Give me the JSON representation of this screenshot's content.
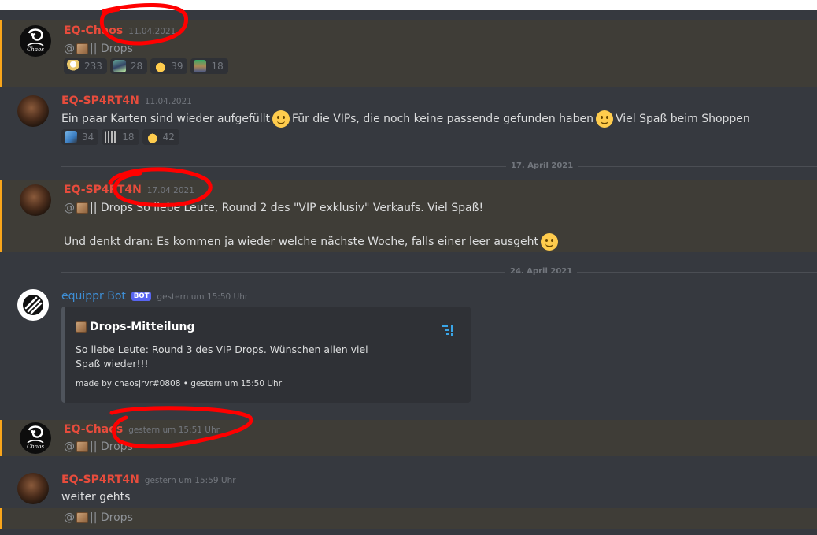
{
  "colors": {
    "background": "#36393f",
    "mention_highlight": "#3f3d37",
    "mention_border": "#faa61a",
    "username_red": "#e74c3c",
    "bot_name": "#3e8fd6",
    "timestamp": "#72767d",
    "annotation_red": "#ff0000"
  },
  "messages": [
    {
      "author": "EQ-Chaos",
      "timestamp": "11.04.2021",
      "at": "@",
      "role": "|| Drops",
      "reactions": [
        {
          "icon": "duck-emoji-icon",
          "count": "233"
        },
        {
          "icon": "loot-emoji-icon",
          "count": "28"
        },
        {
          "icon": "thumbs-up-icon",
          "count": "39"
        },
        {
          "icon": "hat-emoji-icon",
          "count": "18"
        }
      ]
    },
    {
      "author": "EQ-SP4RT4N",
      "timestamp": "11.04.2021",
      "text_a": "Ein paar Karten sind wieder aufgefüllt",
      "text_b": "Für die VIPs, die noch keine passende gefunden haben",
      "text_c": "Viel Spaß beim Shoppen",
      "reactions": [
        {
          "icon": "player-emoji-icon",
          "count": "34"
        },
        {
          "icon": "discount-off-icon",
          "count": "18"
        },
        {
          "icon": "thumbs-up-icon",
          "count": "42"
        }
      ]
    },
    {
      "author": "EQ-SP4RT4N",
      "timestamp": "17.04.2021",
      "at": "@",
      "text": "|| Drops So liebe Leute, Round 2 des \"VIP exklusiv\" Verkaufs. Viel Spaß!",
      "text2": "Und denkt dran: Es kommen ja wieder welche nächste Woche, falls einer leer ausgeht"
    },
    {
      "author": "equippr Bot",
      "badge": "BOT",
      "timestamp": "gestern um 15:50 Uhr",
      "embed": {
        "title": "Drops-Mitteilung",
        "description": "So liebe Leute: Round 3 des VIP Drops. Wünschen allen viel Spaß wieder!!!",
        "footer": "made by chaosjrvr#0808 • gestern um 15:50 Uhr"
      }
    },
    {
      "author": "EQ-Chaos",
      "timestamp": "gestern um 15:51 Uhr",
      "at": "@",
      "role": "|| Drops"
    },
    {
      "author": "EQ-SP4RT4N",
      "timestamp": "gestern um 15:59 Uhr",
      "text": "weiter gehts",
      "at": "@",
      "role": "|| Drops"
    }
  ],
  "dividers": [
    "17. April 2021",
    "24. April 2021"
  ]
}
